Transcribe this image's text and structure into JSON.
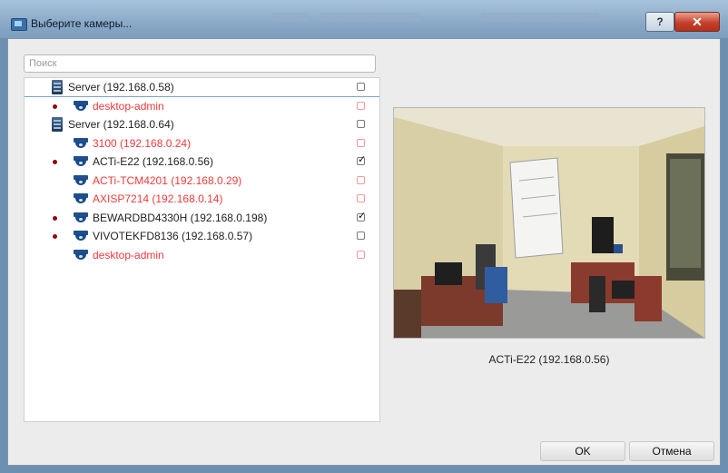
{
  "window": {
    "title": "Выберите камеры...",
    "help_label": "?",
    "close_label": "✕"
  },
  "search": {
    "placeholder": "Поиск",
    "value": ""
  },
  "tree": [
    {
      "kind": "server",
      "label": "Server (192.168.0.58)",
      "color": "#222222",
      "dot": false,
      "checked": false
    },
    {
      "kind": "camera",
      "label": "desktop-admin",
      "color": "#ee3b3b",
      "dot": true,
      "checked": false
    },
    {
      "kind": "server",
      "label": "Server (192.168.0.64)",
      "color": "#222222",
      "dot": false,
      "checked": false
    },
    {
      "kind": "camera",
      "label": "3100 (192.168.0.24)",
      "color": "#ee3b3b",
      "dot": false,
      "checked": false
    },
    {
      "kind": "camera",
      "label": "ACTi-E22 (192.168.0.56)",
      "color": "#222222",
      "dot": true,
      "checked": true
    },
    {
      "kind": "camera",
      "label": "ACTi-TCM4201 (192.168.0.29)",
      "color": "#ee3b3b",
      "dot": false,
      "checked": false
    },
    {
      "kind": "camera",
      "label": "AXISP7214 (192.168.0.14)",
      "color": "#ee3b3b",
      "dot": false,
      "checked": false
    },
    {
      "kind": "camera",
      "label": "BEWARDBD4330H (192.168.0.198)",
      "color": "#222222",
      "dot": true,
      "checked": true
    },
    {
      "kind": "camera",
      "label": "VIVOTEKFD8136 (192.168.0.57)",
      "color": "#222222",
      "dot": true,
      "checked": false
    },
    {
      "kind": "camera",
      "label": "desktop-admin",
      "color": "#ee3b3b",
      "dot": false,
      "checked": false
    }
  ],
  "preview": {
    "caption": "ACTi-E22 (192.168.0.56)"
  },
  "buttons": {
    "ok": "OK",
    "cancel": "Отмена"
  }
}
